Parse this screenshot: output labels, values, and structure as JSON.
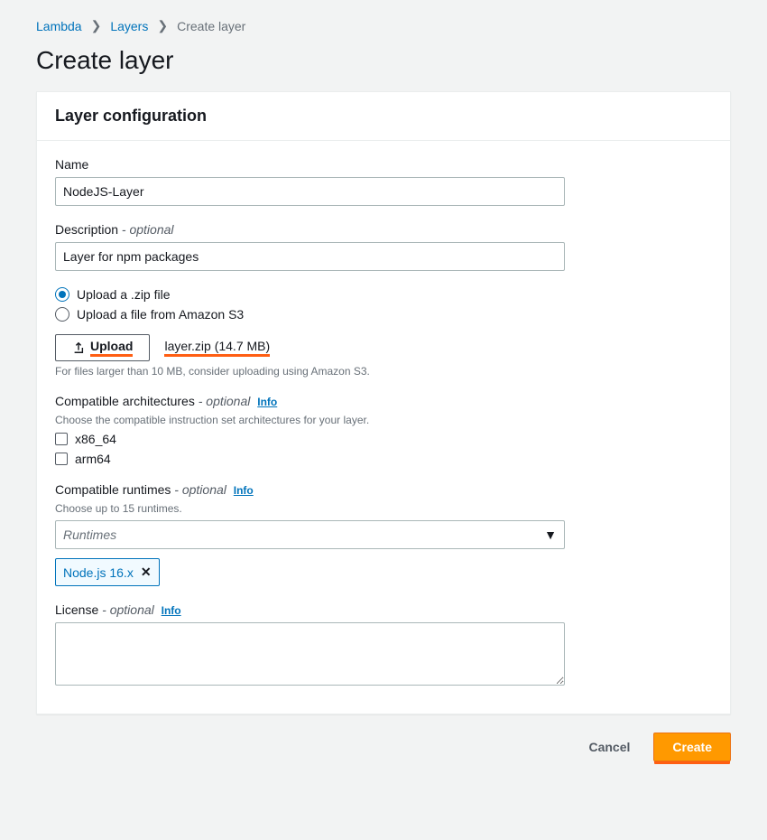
{
  "breadcrumb": {
    "root": "Lambda",
    "parent": "Layers",
    "current": "Create layer"
  },
  "page_title": "Create layer",
  "panel": {
    "heading": "Layer configuration",
    "name": {
      "label": "Name",
      "value": "NodeJS-Layer"
    },
    "description": {
      "label": "Description",
      "optional": "- optional",
      "value": "Layer for npm packages"
    },
    "source": {
      "upload_zip": "Upload a .zip file",
      "upload_s3": "Upload a file from Amazon S3",
      "upload_button": "Upload",
      "file_name": "layer.zip (14.7 MB)",
      "help": "For files larger than 10 MB, consider uploading using Amazon S3."
    },
    "architectures": {
      "label": "Compatible architectures",
      "optional": "- optional",
      "info": "Info",
      "help": "Choose the compatible instruction set architectures for your layer.",
      "opt1": "x86_64",
      "opt2": "arm64"
    },
    "runtimes": {
      "label": "Compatible runtimes",
      "optional": "- optional",
      "info": "Info",
      "help": "Choose up to 15 runtimes.",
      "placeholder": "Runtimes",
      "selected_token": "Node.js 16.x"
    },
    "license": {
      "label": "License",
      "optional": "- optional",
      "info": "Info",
      "value": ""
    }
  },
  "footer": {
    "cancel": "Cancel",
    "create": "Create"
  }
}
